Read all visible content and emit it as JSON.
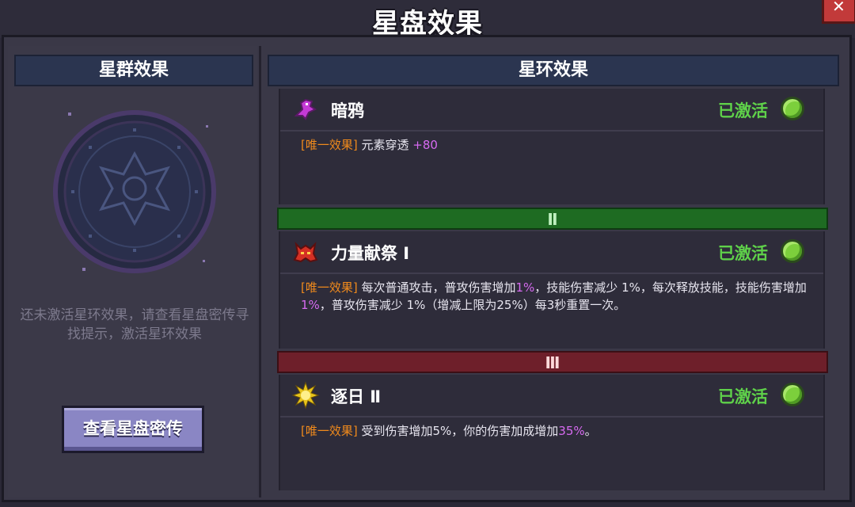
{
  "window": {
    "title": "星盘效果",
    "close_icon": "close-icon"
  },
  "left": {
    "header": "星群效果",
    "message": "还未激活星环效果，请查看星盘密传寻找提示，激活星环效果",
    "button_label": "查看星盘密传"
  },
  "right": {
    "header": "星环效果",
    "effects": [
      {
        "icon": "raven-icon",
        "name": "暗鸦",
        "status": "已激活",
        "tag": "[唯一效果]",
        "desc_a": " 元素穿透 ",
        "desc_hl": "+80"
      },
      {
        "icon": "demon-icon",
        "name": "力量献祭 Ⅰ",
        "status": "已激活",
        "tag": "[唯一效果]",
        "desc_a": " 每次普通攻击，普攻伤害增加",
        "hl1": "1%",
        "desc_b": "，技能伤害减少 1%，每次释放技能，技能伤害增加",
        "hl2": "1%",
        "desc_c": "，普攻伤害减少 1%（增减上限为25%）每3秒重置一次。"
      },
      {
        "icon": "sun-icon",
        "name": "逐日 Ⅱ",
        "status": "已激活",
        "tag": "[唯一效果]",
        "desc_a": " 受到伤害增加5%，你的伤害加成增加",
        "desc_hl": "35%",
        "desc_end": "。"
      }
    ],
    "tiers": [
      "Ⅱ",
      "Ⅲ"
    ]
  },
  "colors": {
    "active": "#5fd14a",
    "tag": "#f08a1c",
    "highlight": "#d66af0",
    "tier2": "#1e6b22",
    "tier3": "#6e1f2a"
  }
}
